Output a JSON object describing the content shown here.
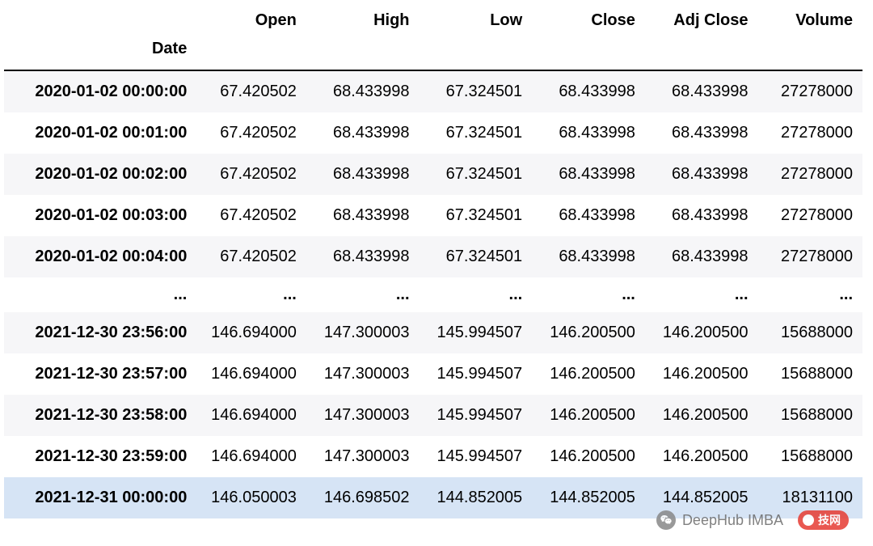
{
  "chart_data": {
    "type": "table",
    "index_name": "Date",
    "columns": [
      "Open",
      "High",
      "Low",
      "Close",
      "Adj Close",
      "Volume"
    ],
    "rows": [
      {
        "index": "2020-01-02 00:00:00",
        "values": [
          "67.420502",
          "68.433998",
          "67.324501",
          "68.433998",
          "68.433998",
          "27278000"
        ],
        "kind": "data"
      },
      {
        "index": "2020-01-02 00:01:00",
        "values": [
          "67.420502",
          "68.433998",
          "67.324501",
          "68.433998",
          "68.433998",
          "27278000"
        ],
        "kind": "data"
      },
      {
        "index": "2020-01-02 00:02:00",
        "values": [
          "67.420502",
          "68.433998",
          "67.324501",
          "68.433998",
          "68.433998",
          "27278000"
        ],
        "kind": "data"
      },
      {
        "index": "2020-01-02 00:03:00",
        "values": [
          "67.420502",
          "68.433998",
          "67.324501",
          "68.433998",
          "68.433998",
          "27278000"
        ],
        "kind": "data"
      },
      {
        "index": "2020-01-02 00:04:00",
        "values": [
          "67.420502",
          "68.433998",
          "67.324501",
          "68.433998",
          "68.433998",
          "27278000"
        ],
        "kind": "data"
      },
      {
        "index": "...",
        "values": [
          "...",
          "...",
          "...",
          "...",
          "...",
          "..."
        ],
        "kind": "ellipsis"
      },
      {
        "index": "2021-12-30 23:56:00",
        "values": [
          "146.694000",
          "147.300003",
          "145.994507",
          "146.200500",
          "146.200500",
          "15688000"
        ],
        "kind": "data"
      },
      {
        "index": "2021-12-30 23:57:00",
        "values": [
          "146.694000",
          "147.300003",
          "145.994507",
          "146.200500",
          "146.200500",
          "15688000"
        ],
        "kind": "data"
      },
      {
        "index": "2021-12-30 23:58:00",
        "values": [
          "146.694000",
          "147.300003",
          "145.994507",
          "146.200500",
          "146.200500",
          "15688000"
        ],
        "kind": "data"
      },
      {
        "index": "2021-12-30 23:59:00",
        "values": [
          "146.694000",
          "147.300003",
          "145.994507",
          "146.200500",
          "146.200500",
          "15688000"
        ],
        "kind": "data"
      },
      {
        "index": "2021-12-31 00:00:00",
        "values": [
          "146.050003",
          "146.698502",
          "144.852005",
          "144.852005",
          "144.852005",
          "18131100"
        ],
        "kind": "highlight"
      }
    ]
  },
  "watermark": {
    "text": "DeepHub IMBA",
    "pill_text": "技网"
  }
}
